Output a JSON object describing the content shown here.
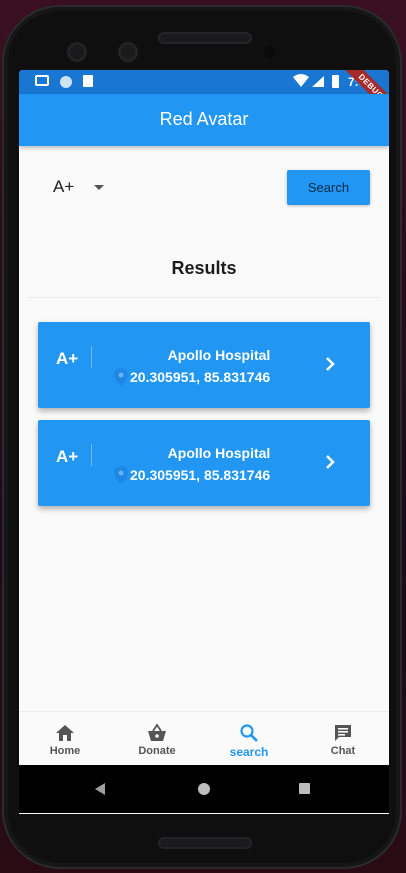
{
  "status_bar": {
    "time": "7:45",
    "debug_banner": "DEBUG"
  },
  "app_bar": {
    "title": "Red Avatar"
  },
  "filter": {
    "selected_blood_group": "A+",
    "search_label": "Search"
  },
  "results": {
    "heading": "Results",
    "items": [
      {
        "blood_group": "A+",
        "name": "Apollo Hospital",
        "coords": "20.305951, 85.831746"
      },
      {
        "blood_group": "A+",
        "name": "Apollo Hospital",
        "coords": "20.305951, 85.831746"
      }
    ]
  },
  "bottom_nav": [
    {
      "label": "Home",
      "icon": "home-icon"
    },
    {
      "label": "Donate",
      "icon": "basket-icon"
    },
    {
      "label": "search",
      "icon": "search-icon",
      "active": true
    },
    {
      "label": "Chat",
      "icon": "chat-icon"
    }
  ],
  "colors": {
    "primary": "#2196f3",
    "status_bar": "#1976d2",
    "active_nav": "#2196f3"
  }
}
